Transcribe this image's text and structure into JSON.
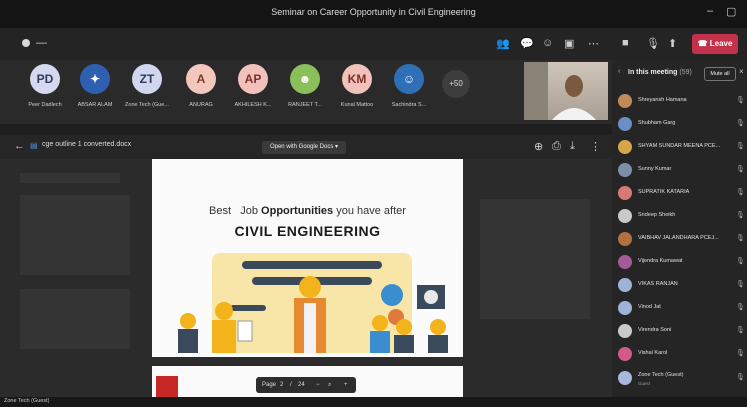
{
  "window": {
    "title": "Seminar on Career Opportunity in Civil Engineering"
  },
  "toolbar": {
    "leave_label": "Leave"
  },
  "gallery": {
    "participants": [
      {
        "initials": "PD",
        "name": "Peer Dadlech",
        "color": "#d4d9f0",
        "text": "#333a5a"
      },
      {
        "initials": "",
        "name": "ABSAR ALAM",
        "color": "#2f5fb0",
        "text": "#fff"
      },
      {
        "initials": "ZT",
        "name": "Zone Tech (Gue...",
        "color": "#d0d7ef",
        "text": "#333a5a"
      },
      {
        "initials": "A",
        "name": "ANURAG",
        "color": "#f3c7bb",
        "text": "#7a3b2a"
      },
      {
        "initials": "AP",
        "name": "AKHILESH K...",
        "color": "#f3c1bc",
        "text": "#7a2f2a"
      },
      {
        "initials": "",
        "name": "RANJEET T...",
        "color": "#8bbf5a",
        "text": "#fff"
      },
      {
        "initials": "KM",
        "name": "Kunal Mattoo",
        "color": "#f1c1bb",
        "text": "#7a2f2a"
      },
      {
        "initials": "",
        "name": "Sachindra S...",
        "color": "#2e6fb5",
        "text": "#fff"
      }
    ],
    "overflow_label": "+50"
  },
  "document": {
    "file_name": "cge outline 1 converted.docx",
    "open_with_label": "Open with Google Docs",
    "slide_line1_a": "Best",
    "slide_line1_b": "Job",
    "slide_line1_c": "Opportunities",
    "slide_line1_d": "you have after",
    "slide_line2": "CIVIL ENGINEERING",
    "page_label": "Page",
    "page_current": "2",
    "page_sep": "/",
    "page_total": "24"
  },
  "panel": {
    "title": "In this meeting",
    "count": "(59)",
    "mute_all_label": "Mute all",
    "participants": [
      {
        "name": "Shreyansh Hamana",
        "color": "#c08a5a"
      },
      {
        "name": "Shubham Garg",
        "color": "#6a8fc7"
      },
      {
        "name": "SHYAM SUNDAR MEENA PCE...",
        "color": "#d6a44a"
      },
      {
        "name": "Sunny Kumar",
        "color": "#7d8fa8"
      },
      {
        "name": "SUPRATIK KATARIA",
        "color": "#d57a74"
      },
      {
        "name": "Sndeep Sheikh",
        "color": "#c9c9c9"
      },
      {
        "name": "VAIBHAV JALANDHARA PCEJ...",
        "color": "#b07040"
      },
      {
        "name": "Vijendra Kumawat",
        "color": "#a35b9a"
      },
      {
        "name": "VIKAS RANJAN",
        "color": "#9fb3d6"
      },
      {
        "name": "Vinod Jat",
        "color": "#9fb3d6"
      },
      {
        "name": "Virendra Soni",
        "color": "#c9c9c9"
      },
      {
        "name": "Vishal Karol",
        "color": "#d05a8a"
      },
      {
        "name": "Zone Tech (Guest)",
        "sub": "Guest",
        "color": "#a8b7dc"
      }
    ]
  },
  "status": {
    "label": "Zone Tech (Guest)"
  }
}
